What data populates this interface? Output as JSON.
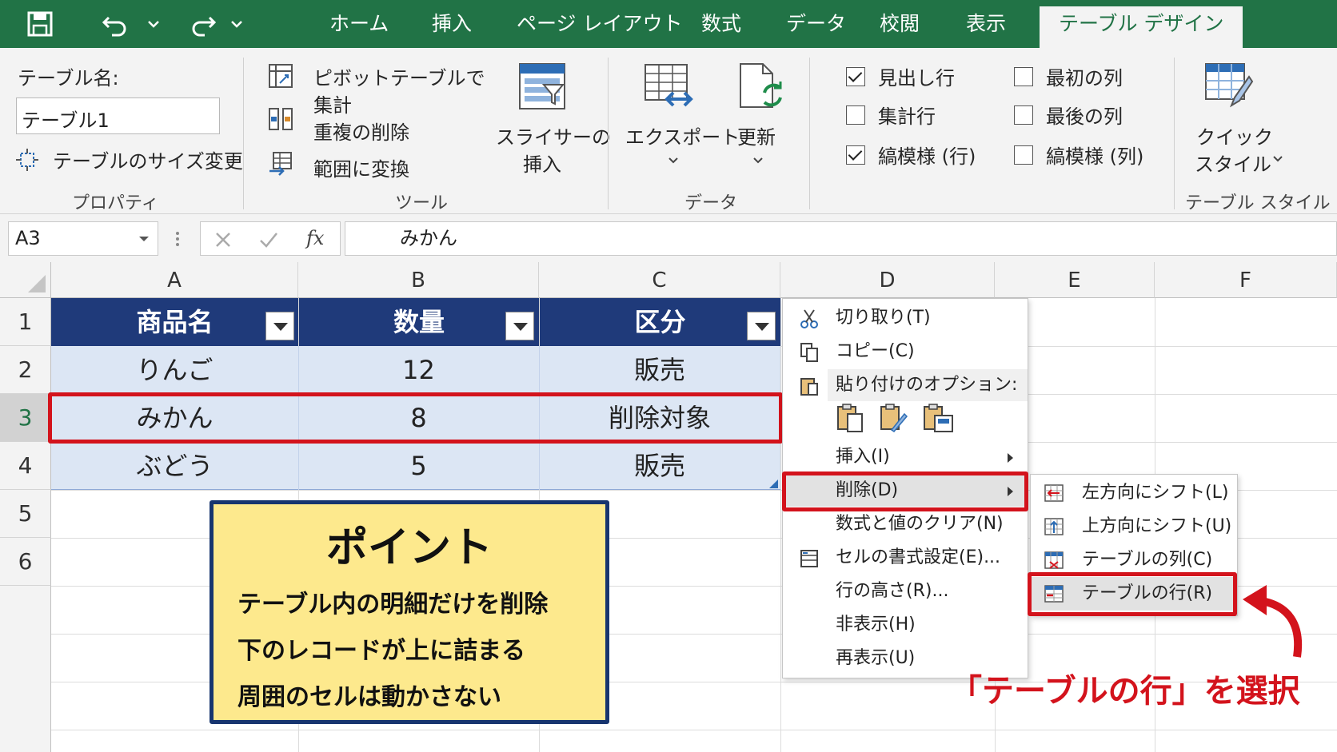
{
  "quick_access": {
    "save_icon": "save-icon",
    "undo_icon": "undo-icon",
    "redo_icon": "redo-icon"
  },
  "tabs": [
    {
      "label": "ホーム"
    },
    {
      "label": "挿入"
    },
    {
      "label": "ページ レイアウト"
    },
    {
      "label": "数式"
    },
    {
      "label": "データ"
    },
    {
      "label": "校閲"
    },
    {
      "label": "表示"
    },
    {
      "label": "テーブル デザイン"
    }
  ],
  "ribbon": {
    "properties": {
      "table_name_label": "テーブル名:",
      "table_name_value": "テーブル1",
      "resize_label": "テーブルのサイズ変更",
      "group_label": "プロパティ"
    },
    "tools": {
      "pivot_line1": "ピボットテーブルで",
      "pivot_line2": "集計",
      "remove_duplicates": "重複の削除",
      "convert_to_range": "範囲に変換",
      "slicer_line1": "スライサーの",
      "slicer_line2": "挿入",
      "group_label": "ツール"
    },
    "data": {
      "export_label": "エクスポート",
      "refresh_label": "更新",
      "group_label": "データ"
    },
    "style_options": {
      "header_row": "見出し行",
      "total_row": "集計行",
      "banded_rows": "縞模様 (行)",
      "first_column": "最初の列",
      "last_column": "最後の列",
      "banded_columns": "縞模様 (列)"
    },
    "table_styles": {
      "quick_line1": "クイック",
      "quick_line2": "スタイル",
      "group_label": "テーブル スタイル"
    }
  },
  "formula_bar": {
    "name_box": "A3",
    "fx_label": "fx",
    "value": "みかん"
  },
  "columns": [
    "A",
    "B",
    "C",
    "D",
    "E",
    "F"
  ],
  "rows": [
    "1",
    "2",
    "3",
    "4",
    "5",
    "6"
  ],
  "table": {
    "headers": [
      "商品名",
      "数量",
      "区分"
    ],
    "data": [
      [
        "りんご",
        "12",
        "販売"
      ],
      [
        "みかん",
        "8",
        "削除対象"
      ],
      [
        "ぶどう",
        "5",
        "販売"
      ]
    ]
  },
  "context_menu": {
    "cut": "切り取り(T)",
    "copy": "コピー(C)",
    "paste_options": "貼り付けのオプション:",
    "insert": "挿入(I)",
    "delete": "削除(D)",
    "clear": "数式と値のクリア(N)",
    "format_cells": "セルの書式設定(E)...",
    "row_height": "行の高さ(R)...",
    "hide": "非表示(H)",
    "unhide": "再表示(U)"
  },
  "submenu": {
    "shift_left": "左方向にシフト(L)",
    "shift_up": "上方向にシフト(U)",
    "table_columns": "テーブルの列(C)",
    "table_rows": "テーブルの行(R)"
  },
  "point_box": {
    "title": "ポイント",
    "lines": [
      "テーブル内の明細だけを削除",
      "下のレコードが上に詰まる",
      "周囲のセルは動かさない"
    ]
  },
  "callout": "「テーブルの行」を選択",
  "colors": {
    "excel_green": "#217346",
    "table_header": "#1f3a7a",
    "band": "#dce6f4",
    "highlight_red": "#d3131c",
    "point_bg": "#fde98d"
  }
}
